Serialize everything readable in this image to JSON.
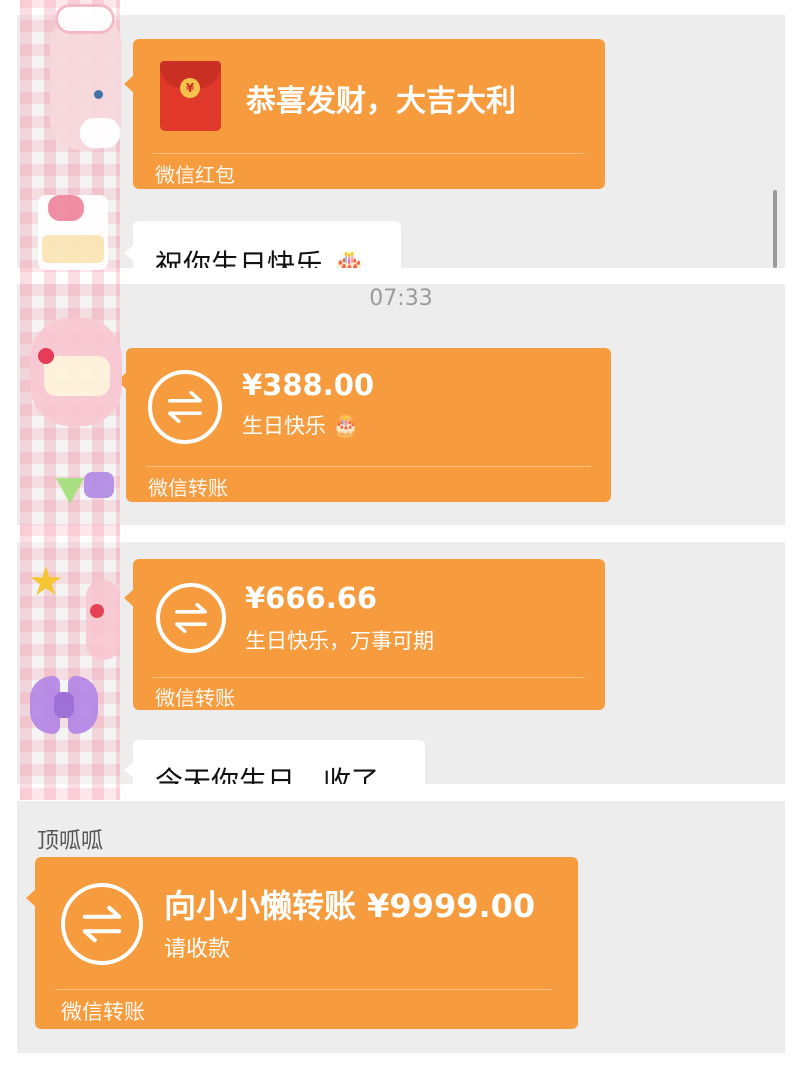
{
  "chat": {
    "red_packet": {
      "title": "恭喜发财，大吉大利",
      "footer": "微信红包",
      "symbol": "¥"
    },
    "message_birthday": {
      "text": "祝你生日快乐",
      "emoji": "🎂"
    },
    "timestamp": "07:33",
    "transfer_1": {
      "amount": "¥388.00",
      "note": "生日快乐",
      "note_emoji": "🎂",
      "footer": "微信转账"
    },
    "transfer_2": {
      "amount": "¥666.66",
      "note": "生日快乐，万事可期",
      "footer": "微信转账"
    },
    "message_today": {
      "text": "今天你生日，收了"
    },
    "sender_name": "顶呱呱",
    "transfer_3": {
      "amount": "向小小懒转账 ¥9999.00",
      "note": "请收款",
      "footer": "微信转账"
    }
  },
  "colors": {
    "accent": "#f79c3e",
    "background": "#ededed",
    "red_packet": "#e0392b"
  }
}
